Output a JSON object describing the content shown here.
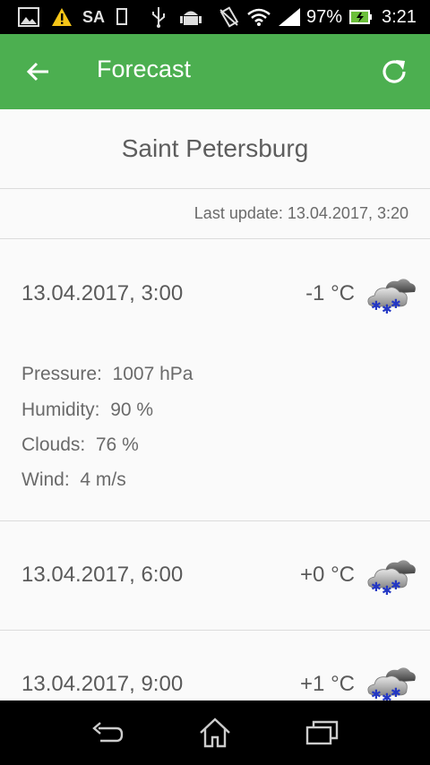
{
  "status_bar": {
    "carrier": "SA",
    "battery": "97%",
    "time": "3:21",
    "icons": [
      "image-icon",
      "warning-icon",
      "sim-icon",
      "usb-icon",
      "android-icon",
      "vibrate-icon",
      "wifi-icon",
      "signal-icon",
      "battery-charging-icon"
    ],
    "warning_color": "#f5c518"
  },
  "app_bar": {
    "title": "Forecast",
    "color": "#4caf50"
  },
  "city": "Saint Petersburg",
  "last_update": "Last update: 13.04.2017, 3:20",
  "forecasts": [
    {
      "date": "13.04.2017, 3:00",
      "temp": "-1 °C",
      "icon": "snow-cloud-icon",
      "details": [
        {
          "label": "Pressure:",
          "value": "1007 hPa"
        },
        {
          "label": "Humidity:",
          "value": "90 %"
        },
        {
          "label": "Clouds:",
          "value": "76 %"
        },
        {
          "label": "Wind:",
          "value": "4 m/s"
        }
      ]
    },
    {
      "date": "13.04.2017, 6:00",
      "temp": "+0 °C",
      "icon": "snow-cloud-icon"
    },
    {
      "date": "13.04.2017, 9:00",
      "temp": "+1 °C",
      "icon": "snow-cloud-icon"
    }
  ]
}
